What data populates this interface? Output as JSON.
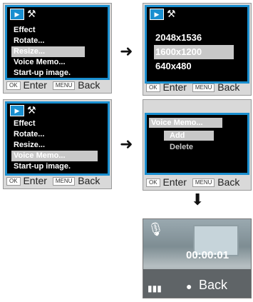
{
  "menu_panels": [
    {
      "items": [
        "Effect",
        "Rotate...",
        "Resize...",
        "Voice Memo...",
        "Start-up image."
      ],
      "selected_index": 2
    },
    {
      "items": [
        "Effect",
        "Rotate...",
        "Resize...",
        "Voice Memo...",
        "Start-up image."
      ],
      "selected_index": 3
    }
  ],
  "resize_panel": {
    "items": [
      "2048x1536",
      "1600x1200",
      "640x480"
    ],
    "selected_index": 1
  },
  "voice_panel": {
    "title": "Voice Memo...",
    "items": [
      "Add",
      "Delete"
    ],
    "selected_index": 0
  },
  "footer": {
    "ok_key": "OK",
    "enter_label": "Enter",
    "menu_key": "MENU",
    "back_label": "Back"
  },
  "recording": {
    "timer": "00:00:01",
    "back_label": "Back"
  },
  "icons": {
    "playback_tab": "playback-icon",
    "setup_tab": "tools-icon",
    "arrow": "right-arrow",
    "mic": "microphone-icon"
  },
  "colors": {
    "accent": "#1a8fd0",
    "highlight": "#c8c8c8",
    "screen": "#000000"
  }
}
